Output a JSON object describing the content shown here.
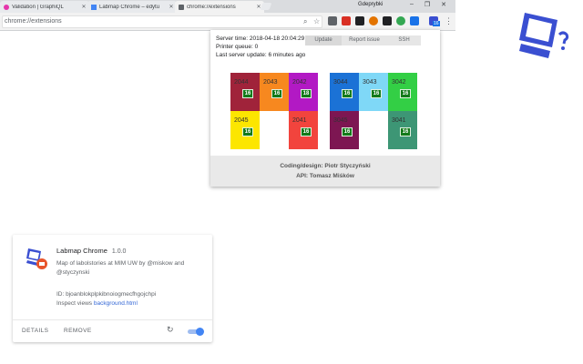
{
  "browser": {
    "tabs": [
      {
        "label": "Validation | GraphiQL",
        "active": false
      },
      {
        "label": "Labmap Chrome – edytu",
        "active": false
      },
      {
        "label": "chrome://extensions",
        "active": true
      }
    ],
    "profile_name": "Gdeprybki",
    "url": "chrome://extensions",
    "extension_badge": "16"
  },
  "popup": {
    "server_time_label": "Server time:",
    "server_time": "2018-04-18 20:04:29",
    "printer_queue_label": "Printer queue:",
    "printer_queue": "0",
    "last_update_label": "Last server update:",
    "last_update": "6 minutes ago",
    "tabs": [
      "Update",
      "Report issue",
      "SSH"
    ],
    "printers": [
      {
        "id": "2044",
        "count": "16",
        "color": "#a0233a",
        "active": true
      },
      {
        "id": "2043",
        "count": "16",
        "color": "#f7881f",
        "active": true
      },
      {
        "id": "2042",
        "count": "18",
        "color": "#b219c4",
        "active": true
      },
      {
        "id": "2045",
        "count": "16",
        "color": "#fce600",
        "active": true
      },
      {
        "id": "",
        "count": "",
        "color": "#ffffff",
        "active": false
      },
      {
        "id": "2041",
        "count": "16",
        "color": "#f2443d",
        "active": true
      },
      {
        "id": "3044",
        "count": "16",
        "color": "#1b72d6",
        "active": true
      },
      {
        "id": "3043",
        "count": "16",
        "color": "#7fd8f7",
        "active": true
      },
      {
        "id": "3042",
        "count": "16",
        "color": "#33cf45",
        "active": true
      },
      {
        "id": "3045",
        "count": "16",
        "color": "#7d1652",
        "active": true
      },
      {
        "id": "",
        "count": "",
        "color": "#ffffff",
        "active": false
      },
      {
        "id": "3041",
        "count": "16",
        "color": "#3d9675",
        "active": true
      }
    ],
    "credits": [
      "Coding/design: Piotr Styczyński",
      "API: Tomasz Miśków"
    ]
  },
  "extension_card": {
    "name": "Labmap Chrome",
    "version": "1.0.0",
    "description": "Map of labolstories at MIM UW by @miskow and @styczynski",
    "id_label": "ID: bjoanblokplpkibnoiogmecfhgojchpi",
    "inspect_label": "Inspect views",
    "inspect_link": "background.html",
    "details_label": "DETAILS",
    "remove_label": "REMOVE",
    "enabled": true
  },
  "colors": {
    "accent": "#4285f4",
    "logo": "#3a4fd1",
    "badge": "#137a1a"
  }
}
